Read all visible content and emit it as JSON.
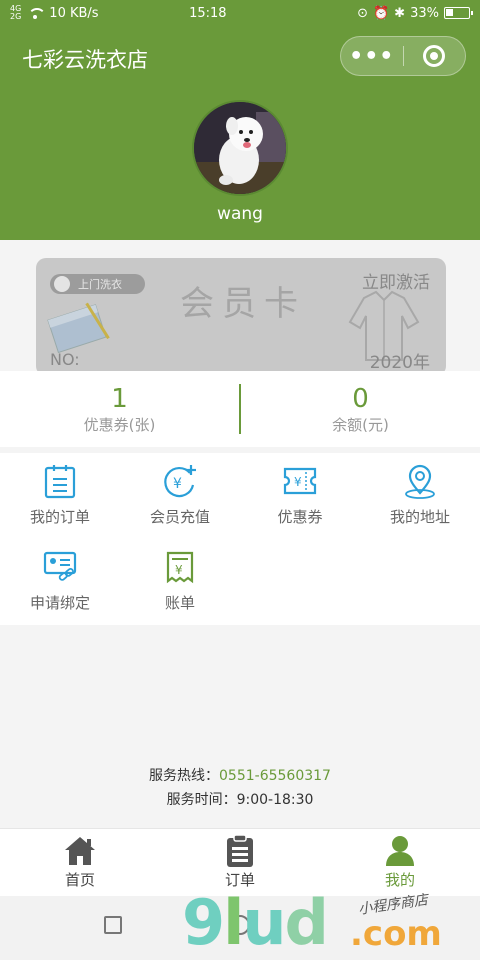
{
  "status_bar": {
    "speed": "10 KB/s",
    "time": "15:18",
    "battery": "33%",
    "signal_top": "4G",
    "signal_bottom": "2G"
  },
  "header": {
    "app_title": "七彩云洗衣店",
    "username": "wang"
  },
  "colors": {
    "brand": "#6a9a3a",
    "card": "#c8c8c8",
    "accent_blue": "#2a9fd8",
    "icon_green": "#6a9a3a"
  },
  "member_card": {
    "badge": "上门洗衣",
    "title": "会员卡",
    "activate": "立即激活",
    "no_label": "NO:",
    "year": "2020年"
  },
  "stats": [
    {
      "value": "1",
      "label": "优惠券(张)"
    },
    {
      "value": "0",
      "label": "余额(元)"
    }
  ],
  "menu": [
    {
      "label": "我的订单",
      "icon": "clipboard-list-icon"
    },
    {
      "label": "会员充值",
      "icon": "yuan-plus-icon"
    },
    {
      "label": "优惠券",
      "icon": "coupon-icon"
    },
    {
      "label": "我的地址",
      "icon": "location-pin-icon"
    },
    {
      "label": "申请绑定",
      "icon": "id-card-link-icon"
    },
    {
      "label": "账单",
      "icon": "receipt-icon"
    }
  ],
  "service": {
    "hotline_label": "服务热线：",
    "hotline": "0551-65560317",
    "hours_label": "服务时间：",
    "hours": "9:00-18:30"
  },
  "tabbar": [
    {
      "label": "首页",
      "icon": "home-icon",
      "active": false
    },
    {
      "label": "订单",
      "icon": "orders-icon",
      "active": false
    },
    {
      "label": "我的",
      "icon": "profile-icon",
      "active": true
    }
  ],
  "watermark": {
    "brand": "9lud",
    "tld": ".com",
    "cn": "小程序商店"
  }
}
